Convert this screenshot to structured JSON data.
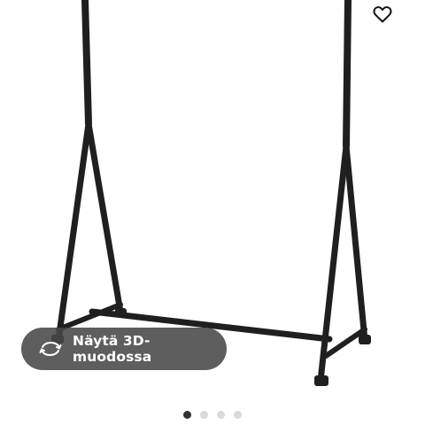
{
  "product": {
    "image_icon": "clothes-rack-product-image"
  },
  "favorite": {
    "icon": "heart-outline-icon"
  },
  "view_3d": {
    "icon": "rotate-3d-icon",
    "label": "Näytä 3D-muodossa"
  },
  "carousel": {
    "total": 4,
    "active_index": 0
  },
  "colors": {
    "button_bg": "#484848",
    "dot_active": "#333333",
    "dot_inactive": "#d9d9d9"
  }
}
